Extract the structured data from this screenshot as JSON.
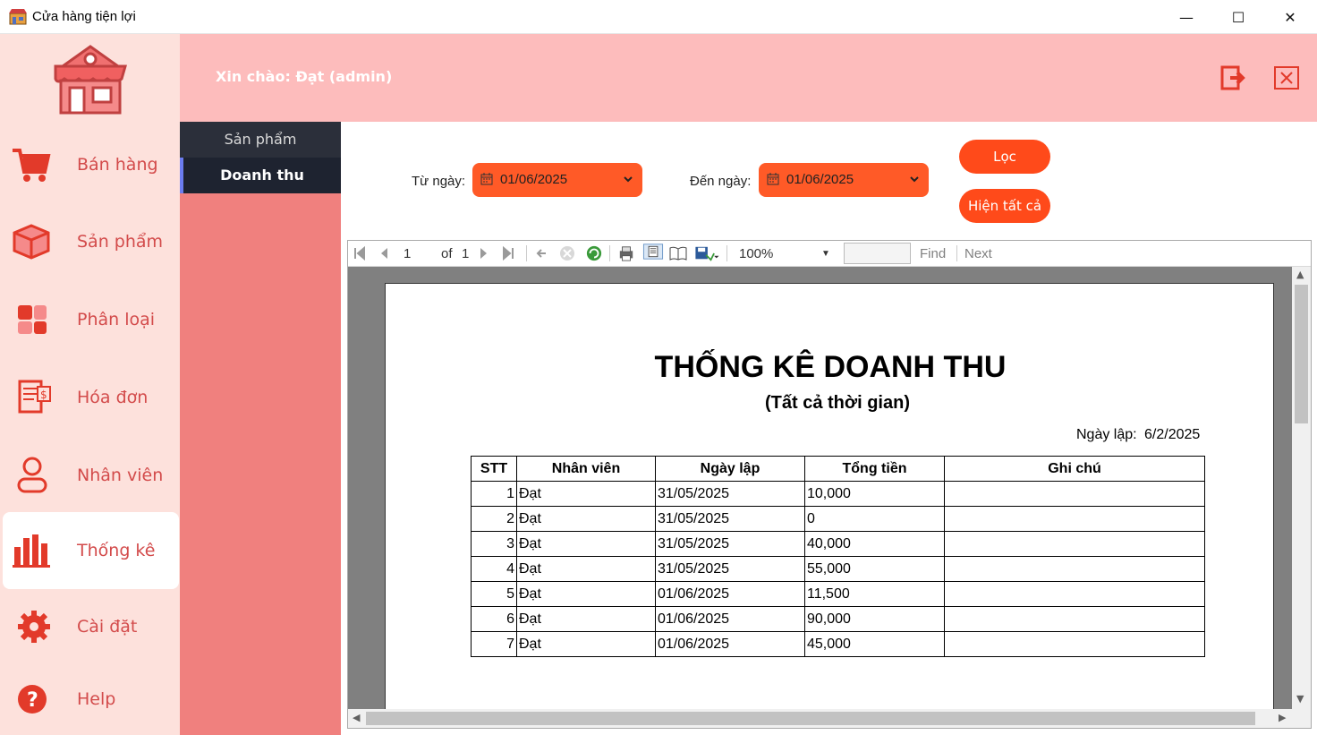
{
  "window": {
    "title": "Cửa hàng tiện lợi",
    "minimize_glyph": "—",
    "maximize_glyph": "☐",
    "close_glyph": "✕"
  },
  "header": {
    "greeting": "Xin chào: Đạt (admin)",
    "logout_icon": "logout-icon",
    "exit_icon": "close-box-icon",
    "bg": "#fdbcbc"
  },
  "sidebar": {
    "items": [
      {
        "label": "Bán hàng",
        "icon": "cart-icon"
      },
      {
        "label": "Sản phẩm",
        "icon": "box-icon"
      },
      {
        "label": "Phân loại",
        "icon": "category-icon"
      },
      {
        "label": "Hóa đơn",
        "icon": "invoice-icon"
      },
      {
        "label": "Nhân viên",
        "icon": "user-icon"
      },
      {
        "label": "Thống kê",
        "icon": "bar-chart-icon",
        "active": true
      },
      {
        "label": "Cài đặt",
        "icon": "gear-icon"
      },
      {
        "label": "Help",
        "icon": "help-icon"
      }
    ],
    "accent": "#d34b4b"
  },
  "subnav": {
    "items": [
      {
        "label": "Sản phẩm"
      },
      {
        "label": "Doanh thu",
        "active": true
      }
    ]
  },
  "filter": {
    "from_label": "Từ ngày:",
    "from_value": "01/06/2025",
    "to_label": "Đến ngày:",
    "to_value": "01/06/2025",
    "filter_button": "Lọc",
    "show_all_button": "Hiện tất cả",
    "accent": "#ff5a27"
  },
  "toolbar": {
    "page_current": "1",
    "page_of": "of",
    "page_total": "1",
    "zoom": "100%",
    "find_label": "Find",
    "next_label": "Next"
  },
  "report": {
    "title": "THỐNG KÊ DOANH THU",
    "subtitle": "(Tất cả thời gian)",
    "date_label": "Ngày lập:",
    "date_value": "6/2/2025",
    "columns": [
      "STT",
      "Nhân viên",
      "Ngày lập",
      "Tổng tiền",
      "Ghi chú"
    ],
    "rows": [
      {
        "stt": "1",
        "staff": "Đạt",
        "date": "31/05/2025",
        "total": "10,000",
        "note": ""
      },
      {
        "stt": "2",
        "staff": "Đạt",
        "date": "31/05/2025",
        "total": "0",
        "note": ""
      },
      {
        "stt": "3",
        "staff": "Đạt",
        "date": "31/05/2025",
        "total": "40,000",
        "note": ""
      },
      {
        "stt": "4",
        "staff": "Đạt",
        "date": "31/05/2025",
        "total": "55,000",
        "note": ""
      },
      {
        "stt": "5",
        "staff": "Đạt",
        "date": "01/06/2025",
        "total": "11,500",
        "note": ""
      },
      {
        "stt": "6",
        "staff": "Đạt",
        "date": "01/06/2025",
        "total": "90,000",
        "note": ""
      },
      {
        "stt": "7",
        "staff": "Đạt",
        "date": "01/06/2025",
        "total": "45,000",
        "note": ""
      }
    ]
  }
}
